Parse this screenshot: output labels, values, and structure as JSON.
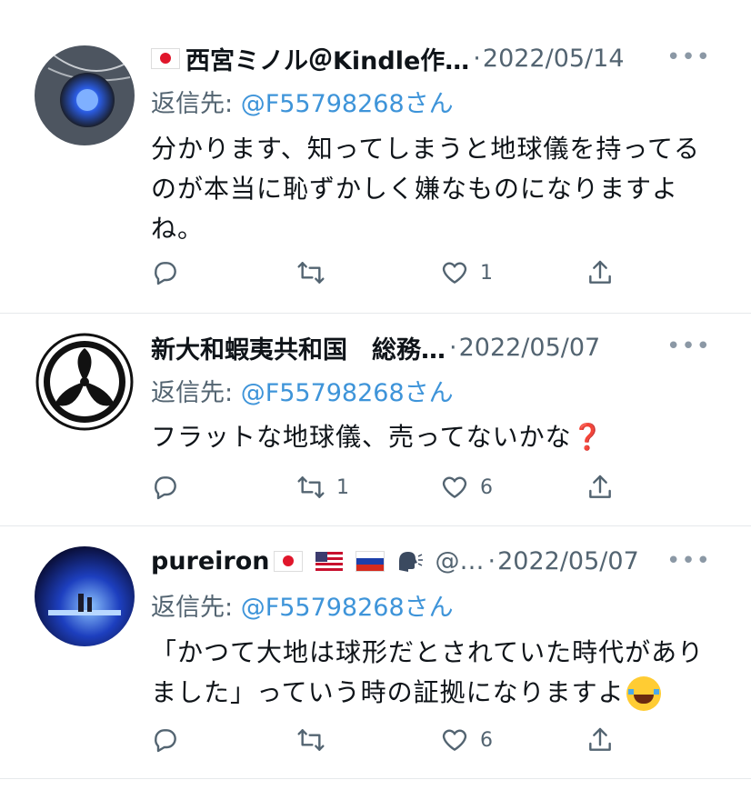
{
  "tweets": [
    {
      "name": "西宮ミノル＠Kindle作…",
      "handle": "",
      "separator": "·",
      "date": "2022/05/14",
      "reply_prefix": "返信先: ",
      "reply_mention": "@F55798268",
      "reply_suffix": "さん",
      "text": "分かります、知ってしまうと地球儀を持ってるのが本当に恥ずかしく嫌なものになりますよね。",
      "reply_count": "",
      "retweet_count": "",
      "like_count": "1",
      "avatar_icon": "blue-glow-avatar"
    },
    {
      "name": "新大和蝦夷共和国　総務…",
      "handle": "",
      "separator": "·",
      "date": "2022/05/07",
      "reply_prefix": "返信先: ",
      "reply_mention": "@F55798268",
      "reply_suffix": "さん",
      "text": "フラットな地球儀、売ってないかな",
      "text_emoji": "❓",
      "reply_count": "",
      "retweet_count": "1",
      "like_count": "6",
      "avatar_icon": "family-crest-avatar"
    },
    {
      "name": "pureiron",
      "handle": "@…",
      "separator": "·",
      "date": "2022/05/07",
      "reply_prefix": "返信先: ",
      "reply_mention": "@F55798268",
      "reply_suffix": "さん",
      "text": "「かつて大地は球形だとされていた時代がありました」っていう時の証拠になりますよ",
      "reply_count": "",
      "retweet_count": "",
      "like_count": "6",
      "avatar_icon": "concert-stage-avatar"
    }
  ],
  "more_label": "•••",
  "colors": {
    "link": "#3e94d9",
    "muted": "#536471",
    "divider": "#e6e9eb"
  }
}
